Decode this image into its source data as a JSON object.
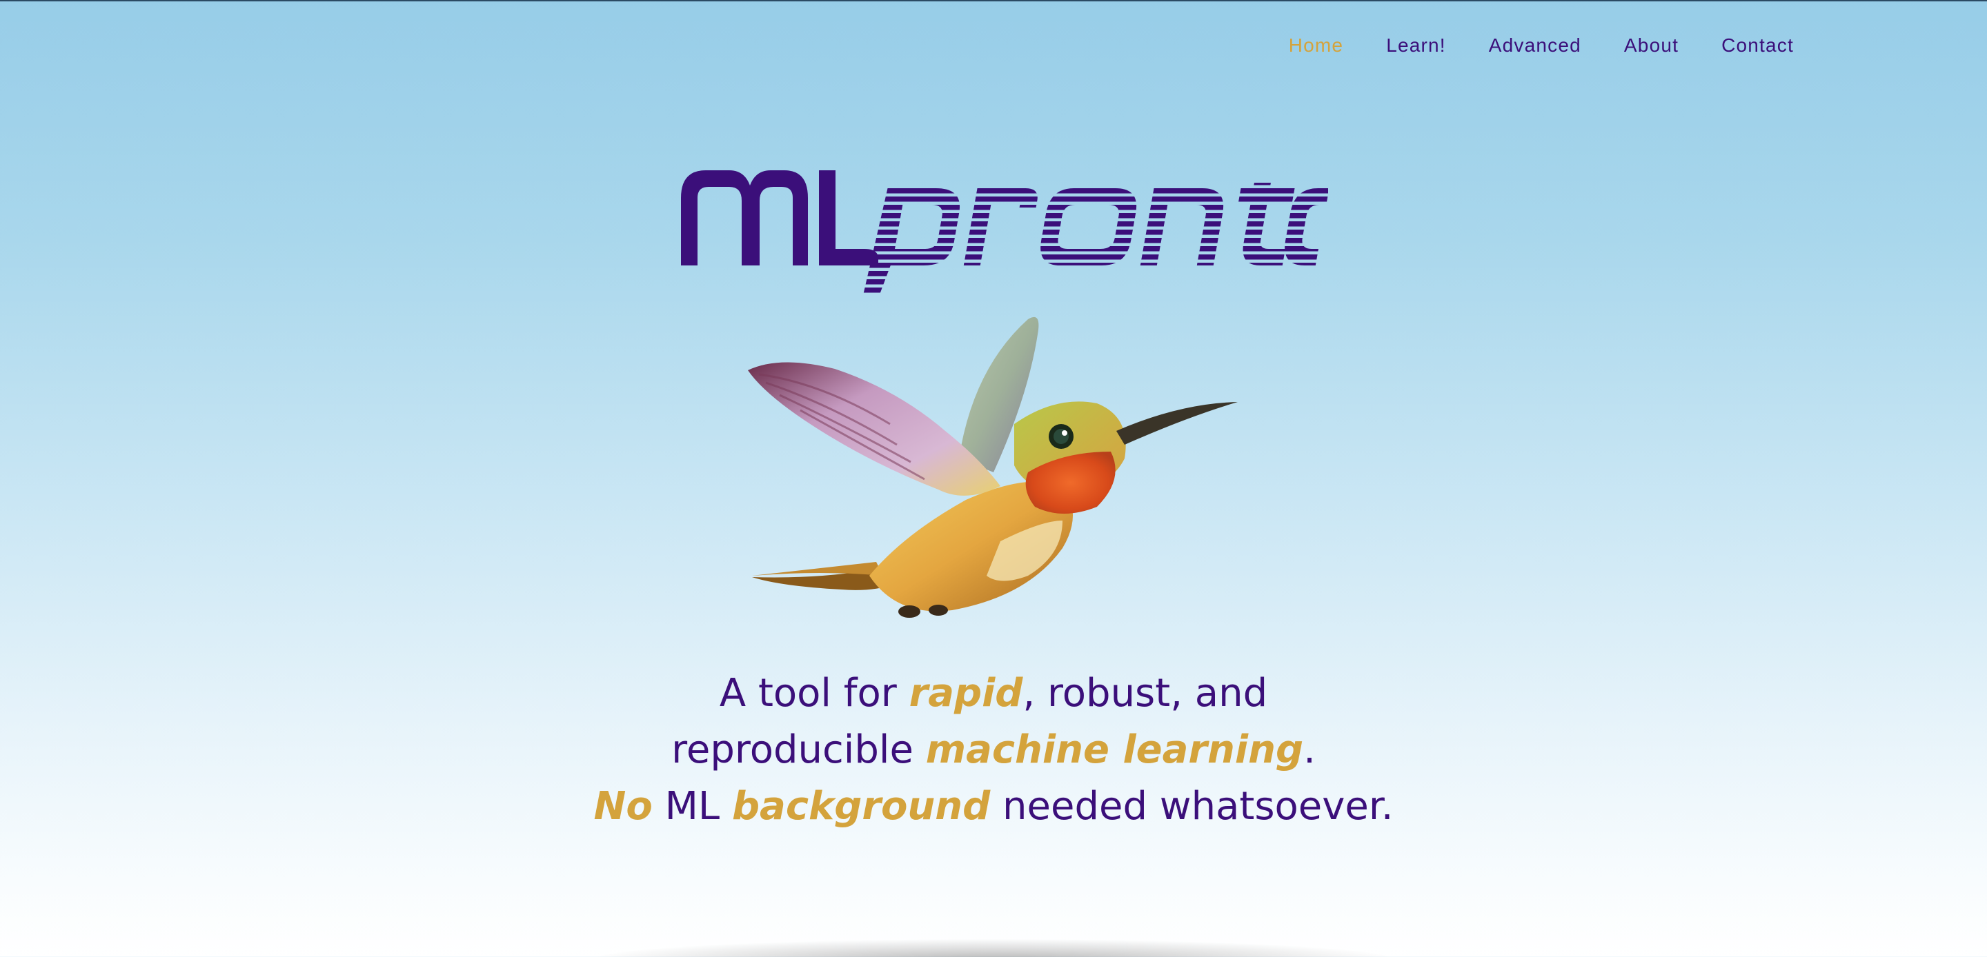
{
  "nav": {
    "items": [
      {
        "label": "Home",
        "active": true
      },
      {
        "label": "Learn!",
        "active": false
      },
      {
        "label": "Advanced",
        "active": false
      },
      {
        "label": "About",
        "active": false
      },
      {
        "label": "Contact",
        "active": false
      }
    ],
    "active_color": "#d4a33c",
    "link_color": "#3b0f7a"
  },
  "logo": {
    "part1": "ML",
    "part2": "pronto",
    "color": "#3b0f7a"
  },
  "hero_image": {
    "icon": "hummingbird-illustration"
  },
  "tagline": {
    "line1": {
      "a": "A tool for ",
      "b": "rapid",
      "c": ", robust, and"
    },
    "line2": {
      "a": "reproducible ",
      "b": "machine learning",
      "c": "."
    },
    "line3": {
      "a": "No",
      "b": " ML ",
      "c": "background",
      "d": " needed whatsoever."
    },
    "text_color": "#3b0f7a",
    "highlight_color": "#d4a33c"
  }
}
